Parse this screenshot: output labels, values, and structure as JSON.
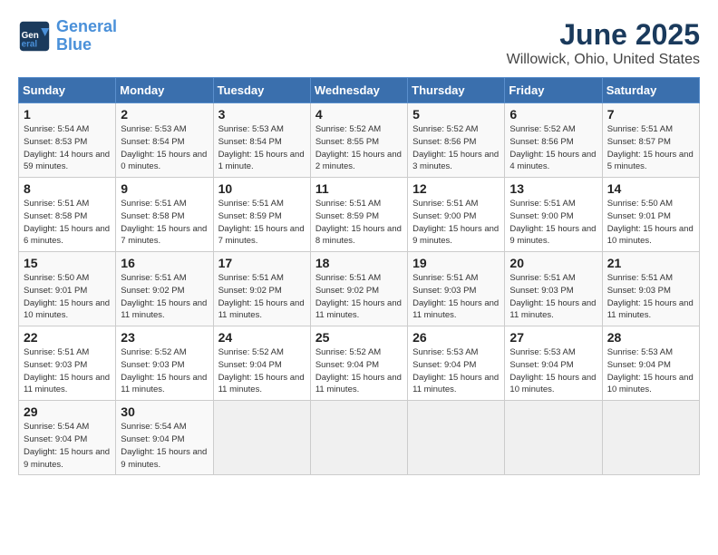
{
  "header": {
    "logo_line1": "General",
    "logo_line2": "Blue",
    "month": "June 2025",
    "location": "Willowick, Ohio, United States"
  },
  "weekdays": [
    "Sunday",
    "Monday",
    "Tuesday",
    "Wednesday",
    "Thursday",
    "Friday",
    "Saturday"
  ],
  "weeks": [
    [
      {
        "day": "1",
        "sunrise": "5:54 AM",
        "sunset": "8:53 PM",
        "daylight": "14 hours and 59 minutes."
      },
      {
        "day": "2",
        "sunrise": "5:53 AM",
        "sunset": "8:54 PM",
        "daylight": "15 hours and 0 minutes."
      },
      {
        "day": "3",
        "sunrise": "5:53 AM",
        "sunset": "8:54 PM",
        "daylight": "15 hours and 1 minute."
      },
      {
        "day": "4",
        "sunrise": "5:52 AM",
        "sunset": "8:55 PM",
        "daylight": "15 hours and 2 minutes."
      },
      {
        "day": "5",
        "sunrise": "5:52 AM",
        "sunset": "8:56 PM",
        "daylight": "15 hours and 3 minutes."
      },
      {
        "day": "6",
        "sunrise": "5:52 AM",
        "sunset": "8:56 PM",
        "daylight": "15 hours and 4 minutes."
      },
      {
        "day": "7",
        "sunrise": "5:51 AM",
        "sunset": "8:57 PM",
        "daylight": "15 hours and 5 minutes."
      }
    ],
    [
      {
        "day": "8",
        "sunrise": "5:51 AM",
        "sunset": "8:58 PM",
        "daylight": "15 hours and 6 minutes."
      },
      {
        "day": "9",
        "sunrise": "5:51 AM",
        "sunset": "8:58 PM",
        "daylight": "15 hours and 7 minutes."
      },
      {
        "day": "10",
        "sunrise": "5:51 AM",
        "sunset": "8:59 PM",
        "daylight": "15 hours and 7 minutes."
      },
      {
        "day": "11",
        "sunrise": "5:51 AM",
        "sunset": "8:59 PM",
        "daylight": "15 hours and 8 minutes."
      },
      {
        "day": "12",
        "sunrise": "5:51 AM",
        "sunset": "9:00 PM",
        "daylight": "15 hours and 9 minutes."
      },
      {
        "day": "13",
        "sunrise": "5:51 AM",
        "sunset": "9:00 PM",
        "daylight": "15 hours and 9 minutes."
      },
      {
        "day": "14",
        "sunrise": "5:50 AM",
        "sunset": "9:01 PM",
        "daylight": "15 hours and 10 minutes."
      }
    ],
    [
      {
        "day": "15",
        "sunrise": "5:50 AM",
        "sunset": "9:01 PM",
        "daylight": "15 hours and 10 minutes."
      },
      {
        "day": "16",
        "sunrise": "5:51 AM",
        "sunset": "9:02 PM",
        "daylight": "15 hours and 11 minutes."
      },
      {
        "day": "17",
        "sunrise": "5:51 AM",
        "sunset": "9:02 PM",
        "daylight": "15 hours and 11 minutes."
      },
      {
        "day": "18",
        "sunrise": "5:51 AM",
        "sunset": "9:02 PM",
        "daylight": "15 hours and 11 minutes."
      },
      {
        "day": "19",
        "sunrise": "5:51 AM",
        "sunset": "9:03 PM",
        "daylight": "15 hours and 11 minutes."
      },
      {
        "day": "20",
        "sunrise": "5:51 AM",
        "sunset": "9:03 PM",
        "daylight": "15 hours and 11 minutes."
      },
      {
        "day": "21",
        "sunrise": "5:51 AM",
        "sunset": "9:03 PM",
        "daylight": "15 hours and 11 minutes."
      }
    ],
    [
      {
        "day": "22",
        "sunrise": "5:51 AM",
        "sunset": "9:03 PM",
        "daylight": "15 hours and 11 minutes."
      },
      {
        "day": "23",
        "sunrise": "5:52 AM",
        "sunset": "9:03 PM",
        "daylight": "15 hours and 11 minutes."
      },
      {
        "day": "24",
        "sunrise": "5:52 AM",
        "sunset": "9:04 PM",
        "daylight": "15 hours and 11 minutes."
      },
      {
        "day": "25",
        "sunrise": "5:52 AM",
        "sunset": "9:04 PM",
        "daylight": "15 hours and 11 minutes."
      },
      {
        "day": "26",
        "sunrise": "5:53 AM",
        "sunset": "9:04 PM",
        "daylight": "15 hours and 11 minutes."
      },
      {
        "day": "27",
        "sunrise": "5:53 AM",
        "sunset": "9:04 PM",
        "daylight": "15 hours and 10 minutes."
      },
      {
        "day": "28",
        "sunrise": "5:53 AM",
        "sunset": "9:04 PM",
        "daylight": "15 hours and 10 minutes."
      }
    ],
    [
      {
        "day": "29",
        "sunrise": "5:54 AM",
        "sunset": "9:04 PM",
        "daylight": "15 hours and 9 minutes."
      },
      {
        "day": "30",
        "sunrise": "5:54 AM",
        "sunset": "9:04 PM",
        "daylight": "15 hours and 9 minutes."
      },
      null,
      null,
      null,
      null,
      null
    ]
  ]
}
